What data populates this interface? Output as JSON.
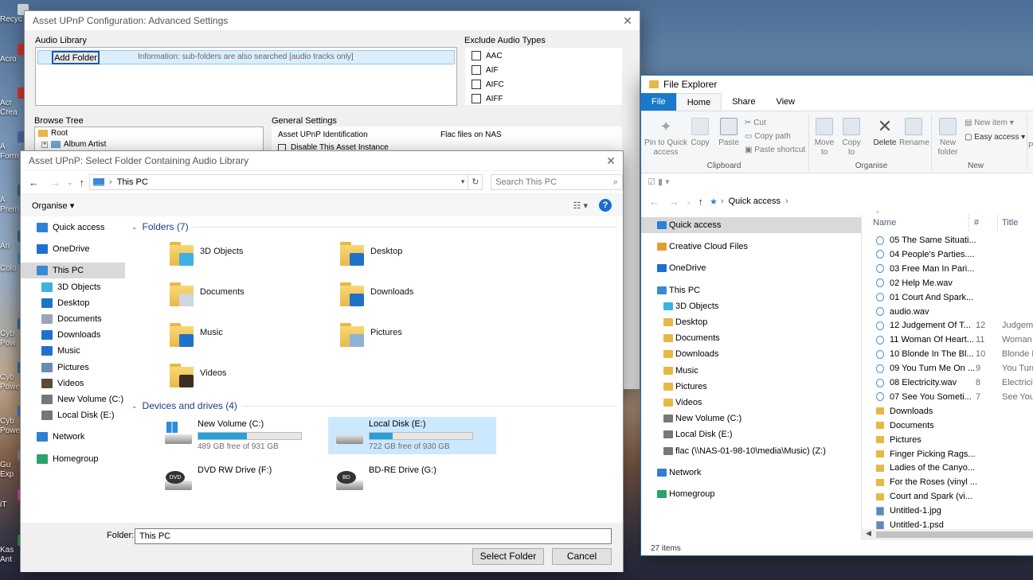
{
  "desktop": {
    "icons": [
      {
        "label": "Recyc",
        "color": "#d0d8e0"
      },
      {
        "label": "Acro",
        "color": "#d8342b"
      },
      {
        "label": "Acr\nCrea",
        "color": "#d8342b"
      },
      {
        "label": "A\nForm",
        "color": "#4a6fa5"
      },
      {
        "label": "A\nPrem",
        "color": "#4a6fa5"
      },
      {
        "label": "An",
        "color": "#4a6fa5"
      },
      {
        "label": "Colo",
        "color": "#3aa8c9"
      },
      {
        "label": "Cyb\nPow",
        "color": "#3a7dc9"
      },
      {
        "label": "Cyb\nPowe",
        "color": "#3a7dc9"
      },
      {
        "label": "Cyb\nPowe",
        "color": "#3a7dc9"
      },
      {
        "label": "Gu\nExp",
        "color": "#888"
      },
      {
        "label": "iT",
        "color": "#c94a9a"
      },
      {
        "label": "Kas\nAnt",
        "color": "#2b9a55"
      }
    ]
  },
  "config": {
    "title": "Asset UPnP Configuration: Advanced Settings",
    "audio_library": "Audio Library",
    "add_folder": "Add Folder",
    "info": "Information: sub-folders are also searched [audio tracks only]",
    "exclude_types_label": "Exclude Audio Types",
    "exclude_types": [
      "AAC",
      "AIF",
      "AIFC",
      "AIFF"
    ],
    "browse_tree": "Browse Tree",
    "tree_root": "Root",
    "tree_child": "Album Artist",
    "general_settings": "General Settings",
    "upnp_id_label": "Asset UPnP Identification",
    "upnp_id_value": "Flac files on NAS",
    "disable_instance": "Disable This Asset Instance"
  },
  "dialog": {
    "title": "Asset UPnP: Select Folder Containing Audio Library",
    "address": "This PC",
    "search_placeholder": "Search This PC",
    "organise": "Organise",
    "sidebar": [
      {
        "label": "Quick access",
        "icon": "star-icon",
        "color": "#2f7fd6",
        "indent": 0,
        "selected": false
      },
      {
        "label": "OneDrive",
        "icon": "cloud-icon",
        "color": "#1e6fd0",
        "indent": 0,
        "selected": false
      },
      {
        "label": "This PC",
        "icon": "pc-icon",
        "color": "#3a8ad6",
        "indent": 0,
        "selected": true
      },
      {
        "label": "3D Objects",
        "icon": "cube-icon",
        "color": "#3db1e0",
        "indent": 1,
        "selected": false
      },
      {
        "label": "Desktop",
        "icon": "desktop-icon",
        "color": "#1e73c9",
        "indent": 1,
        "selected": false
      },
      {
        "label": "Documents",
        "icon": "documents-icon",
        "color": "#9aa5b5",
        "indent": 1,
        "selected": false
      },
      {
        "label": "Downloads",
        "icon": "downloads-icon",
        "color": "#1e73c9",
        "indent": 1,
        "selected": false
      },
      {
        "label": "Music",
        "icon": "music-icon",
        "color": "#1e73c9",
        "indent": 1,
        "selected": false
      },
      {
        "label": "Pictures",
        "icon": "pictures-icon",
        "color": "#6b8bb0",
        "indent": 1,
        "selected": false
      },
      {
        "label": "Videos",
        "icon": "videos-icon",
        "color": "#5a4a3a",
        "indent": 1,
        "selected": false
      },
      {
        "label": "New Volume (C:)",
        "icon": "drive-icon",
        "color": "#777",
        "indent": 1,
        "selected": false
      },
      {
        "label": "Local Disk (E:)",
        "icon": "drive-icon",
        "color": "#777",
        "indent": 1,
        "selected": false
      },
      {
        "label": "Network",
        "icon": "network-icon",
        "color": "#2f7fd6",
        "indent": 0,
        "selected": false
      },
      {
        "label": "Homegroup",
        "icon": "homegroup-icon",
        "color": "#2aa36b",
        "indent": 0,
        "selected": false
      }
    ],
    "folders_header": "Folders (7)",
    "folders": [
      {
        "label": "3D Objects",
        "overlay": "#3db1e0"
      },
      {
        "label": "Desktop",
        "overlay": "#1e73c9"
      },
      {
        "label": "Documents",
        "overlay": "#cfd6df"
      },
      {
        "label": "Downloads",
        "overlay": "#1e73c9"
      },
      {
        "label": "Music",
        "overlay": "#1e73c9"
      },
      {
        "label": "Pictures",
        "overlay": "#8fb3d6"
      },
      {
        "label": "Videos",
        "overlay": "#3b2e22"
      }
    ],
    "drives_header": "Devices and drives (4)",
    "drives": [
      {
        "label": "New Volume (C:)",
        "free": "489 GB free of 931 GB",
        "used_fraction": 0.475,
        "has_bar": true,
        "selected": false,
        "badge": ""
      },
      {
        "label": "Local Disk (E:)",
        "free": "722 GB free of 930 GB",
        "used_fraction": 0.224,
        "has_bar": true,
        "selected": true,
        "badge": ""
      },
      {
        "label": "DVD RW Drive (F:)",
        "free": "",
        "used_fraction": 0,
        "has_bar": false,
        "selected": false,
        "badge": "DVD"
      },
      {
        "label": "BD-RE Drive (G:)",
        "free": "",
        "used_fraction": 0,
        "has_bar": false,
        "selected": false,
        "badge": "BD"
      }
    ],
    "folder_label": "Folder:",
    "folder_value": "This PC",
    "select_button": "Select Folder",
    "cancel_button": "Cancel"
  },
  "explorer": {
    "title": "File Explorer",
    "tabs": [
      "File",
      "Home",
      "Share",
      "View"
    ],
    "ribbon": {
      "pin": "Pin to Quick access",
      "copy": "Copy",
      "paste": "Paste",
      "cut": "Cut",
      "copy_path": "Copy path",
      "paste_shortcut": "Paste shortcut",
      "clipboard": "Clipboard",
      "move_to": "Move to",
      "copy_to": "Copy to",
      "delete": "Delete",
      "rename": "Rename",
      "organise": "Organise",
      "new_folder": "New folder",
      "new_item": "New item",
      "easy_access": "Easy access",
      "new_group": "New",
      "pr": "Pr"
    },
    "address": "Quick access",
    "nav": [
      {
        "label": "Quick access",
        "color": "#2f7fd6",
        "indent": 0,
        "selected": true,
        "gap": 0
      },
      {
        "label": "Creative Cloud Files",
        "color": "#e0a030",
        "indent": 0,
        "selected": false,
        "gap": 1
      },
      {
        "label": "OneDrive",
        "color": "#1e6fd0",
        "indent": 0,
        "selected": false,
        "gap": 1
      },
      {
        "label": "This PC",
        "color": "#3a8ad6",
        "indent": 0,
        "selected": false,
        "gap": 1
      },
      {
        "label": "3D Objects",
        "color": "#3db1e0",
        "indent": 1,
        "selected": false,
        "gap": 0
      },
      {
        "label": "Desktop",
        "color": "#e6b845",
        "indent": 1,
        "selected": false,
        "gap": 0
      },
      {
        "label": "Documents",
        "color": "#e6b845",
        "indent": 1,
        "selected": false,
        "gap": 0
      },
      {
        "label": "Downloads",
        "color": "#e6b845",
        "indent": 1,
        "selected": false,
        "gap": 0
      },
      {
        "label": "Music",
        "color": "#e6b845",
        "indent": 1,
        "selected": false,
        "gap": 0
      },
      {
        "label": "Pictures",
        "color": "#e6b845",
        "indent": 1,
        "selected": false,
        "gap": 0
      },
      {
        "label": "Videos",
        "color": "#e6b845",
        "indent": 1,
        "selected": false,
        "gap": 0
      },
      {
        "label": "New Volume (C:)",
        "color": "#777",
        "indent": 1,
        "selected": false,
        "gap": 0
      },
      {
        "label": "Local Disk (E:)",
        "color": "#777",
        "indent": 1,
        "selected": false,
        "gap": 0
      },
      {
        "label": "flac (\\\\NAS-01-98-10\\media\\Music) (Z:)",
        "color": "#777",
        "indent": 1,
        "selected": false,
        "gap": 0
      },
      {
        "label": "Network",
        "color": "#2f7fd6",
        "indent": 0,
        "selected": false,
        "gap": 1
      },
      {
        "label": "Homegroup",
        "color": "#2aa36b",
        "indent": 0,
        "selected": false,
        "gap": 1
      }
    ],
    "columns": [
      "Name",
      "#",
      "Title"
    ],
    "files": [
      {
        "name": "05 The Same Situati...",
        "num": "",
        "title": "",
        "type": "audio"
      },
      {
        "name": "04 People's Parties....",
        "num": "",
        "title": "",
        "type": "audio"
      },
      {
        "name": "03 Free Man In Pari...",
        "num": "",
        "title": "",
        "type": "audio"
      },
      {
        "name": "02 Help Me.wav",
        "num": "",
        "title": "",
        "type": "audio"
      },
      {
        "name": "01 Court And Spark...",
        "num": "",
        "title": "",
        "type": "audio"
      },
      {
        "name": "audio.wav",
        "num": "",
        "title": "",
        "type": "audio"
      },
      {
        "name": "12 Judgement Of T...",
        "num": "12",
        "title": "Judgeme",
        "type": "audio"
      },
      {
        "name": "11 Woman Of Heart...",
        "num": "11",
        "title": "Woman",
        "type": "audio"
      },
      {
        "name": "10 Blonde In The Bl...",
        "num": "10",
        "title": "Blonde I",
        "type": "audio"
      },
      {
        "name": "09 You Turn Me On ...",
        "num": "9",
        "title": "You Turn",
        "type": "audio"
      },
      {
        "name": "08 Electricity.wav",
        "num": "8",
        "title": "Electricit",
        "type": "audio"
      },
      {
        "name": "07 See You Someti...",
        "num": "7",
        "title": "See You",
        "type": "audio"
      },
      {
        "name": "Downloads",
        "num": "",
        "title": "",
        "type": "folder"
      },
      {
        "name": "Documents",
        "num": "",
        "title": "",
        "type": "folder"
      },
      {
        "name": "Pictures",
        "num": "",
        "title": "",
        "type": "folder"
      },
      {
        "name": "Finger Picking Rags...",
        "num": "",
        "title": "",
        "type": "folder"
      },
      {
        "name": "Ladies of the Canyo...",
        "num": "",
        "title": "",
        "type": "folder"
      },
      {
        "name": "For the Roses (vinyl ...",
        "num": "",
        "title": "",
        "type": "folder"
      },
      {
        "name": "Court and Spark (vi...",
        "num": "",
        "title": "",
        "type": "folder"
      },
      {
        "name": "Untitled-1.jpg",
        "num": "",
        "title": "",
        "type": "image"
      },
      {
        "name": "Untitled-1.psd",
        "num": "",
        "title": "",
        "type": "image"
      }
    ],
    "status": "27 items"
  },
  "colors": {
    "accent": "#0078d7",
    "selection": "#cce8ff",
    "drive_bar": "#26a0da",
    "link_blue": "#1e5aa8"
  }
}
